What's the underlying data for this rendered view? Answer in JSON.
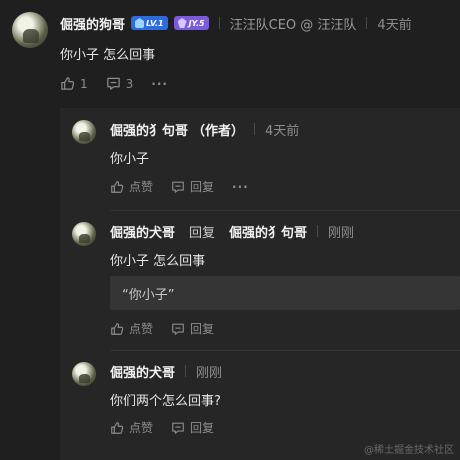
{
  "top": {
    "user": "倔强的狗哥",
    "level_badge": "LV.1",
    "jy_badge": "JY.5",
    "title": "汪汪队CEO @ 汪汪队",
    "time": "4天前",
    "content": "你小子 怎么回事",
    "likes": "1",
    "comments": "3",
    "more": "···"
  },
  "reply1": {
    "user": "倔强的犭句哥",
    "author_tag": "（作者）",
    "time": "4天前",
    "content": "你小子",
    "like_label": "点赞",
    "reply_label": "回复",
    "more": "···"
  },
  "reply2": {
    "user": "倔强的犬哥",
    "reply_word": "回复",
    "target": "倔强的犭句哥",
    "time": "刚刚",
    "content": "你小子 怎么回事",
    "quote": "“你小子”",
    "like_label": "点赞",
    "reply_label": "回复"
  },
  "reply3": {
    "user": "倔强的犬哥",
    "time": "刚刚",
    "content": "你们两个怎么回事?",
    "like_label": "点赞",
    "reply_label": "回复"
  },
  "watermark": "@稀土掘金技术社区"
}
